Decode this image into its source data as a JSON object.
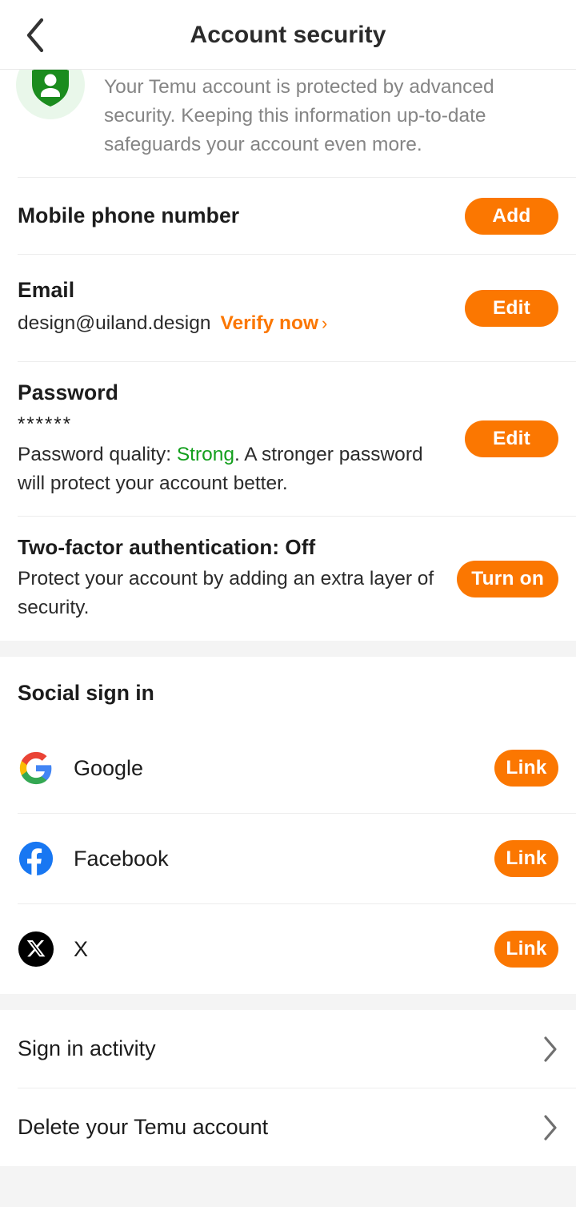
{
  "header": {
    "title": "Account security",
    "back_icon": "chevron-left-icon"
  },
  "banner": {
    "icon": "shield-person-icon",
    "text": "Your Temu account is protected by advanced security. Keeping this information up-to-date safeguards your account even more."
  },
  "security": {
    "phone": {
      "title": "Mobile phone number",
      "action_label": "Add"
    },
    "email": {
      "title": "Email",
      "value": "design@uiland.design",
      "verify_label": "Verify now",
      "verify_chevron": "chevron-right-icon",
      "action_label": "Edit"
    },
    "password": {
      "title": "Password",
      "masked_value": "******",
      "quality_prefix": "Password quality: ",
      "quality_value": "Strong",
      "quality_suffix": ". A stronger password will protect your account better.",
      "action_label": "Edit"
    },
    "two_factor": {
      "title": "Two-factor authentication: Off",
      "description": "Protect your account by adding an extra layer of security.",
      "action_label": "Turn on"
    }
  },
  "social": {
    "section_title": "Social sign in",
    "items": [
      {
        "name": "Google",
        "icon": "google-icon",
        "action_label": "Link"
      },
      {
        "name": "Facebook",
        "icon": "facebook-icon",
        "action_label": "Link"
      },
      {
        "name": "X",
        "icon": "x-twitter-icon",
        "action_label": "Link"
      }
    ]
  },
  "account_links": [
    {
      "label": "Sign in activity",
      "chevron": "chevron-right-icon"
    },
    {
      "label": "Delete your Temu account",
      "chevron": "chevron-right-icon"
    }
  ],
  "colors": {
    "accent_orange": "#FB7701",
    "success_green": "#14A01E",
    "shield_green": "#1B8C1E",
    "shield_bg": "#E9F7EA",
    "facebook_blue": "#1877F2",
    "x_black": "#000000",
    "page_bg": "#F4F4F4",
    "text_primary": "#1C1C1C",
    "text_muted": "#858585"
  }
}
